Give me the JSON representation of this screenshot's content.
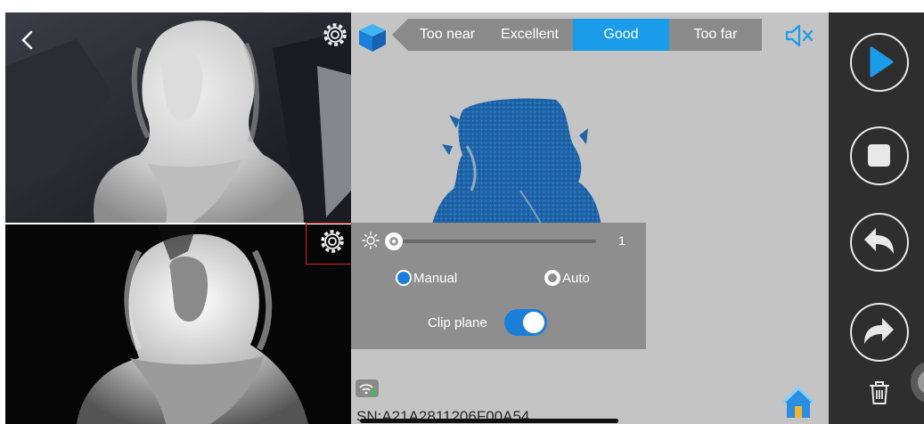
{
  "viewport": {
    "distance_indicator": {
      "options": [
        "Too near",
        "Excellent",
        "Good",
        "Too far"
      ],
      "selected": "Good"
    },
    "brightness": {
      "value": "1",
      "level": 0.0
    },
    "exposure_mode": {
      "manual_label": "Manual",
      "auto_label": "Auto",
      "selected": "Manual"
    },
    "clip_plane": {
      "label": "Clip plane",
      "enabled": true
    },
    "serial_number": "SN:A21A2811206F00A54"
  },
  "icons": {
    "back": "chevron-left-icon",
    "camera_settings": "gear-icon",
    "view_cube": "cube-icon",
    "sound": "speaker-muted-icon",
    "brightness": "sun-icon",
    "connection": "wifi-icon",
    "home": "home-icon",
    "play": "play-icon",
    "stop": "stop-icon",
    "undo": "undo-icon",
    "redo": "redo-icon",
    "delete": "trash-icon"
  },
  "colors": {
    "accent": "#1a9cea",
    "segment_bg": "#8a8a8a",
    "viewport_bg": "#c4c4c4",
    "panel_bg": "#8e8e8e",
    "control_bar_bg": "#2e2e2e",
    "model_blue": "#1f64a8"
  }
}
